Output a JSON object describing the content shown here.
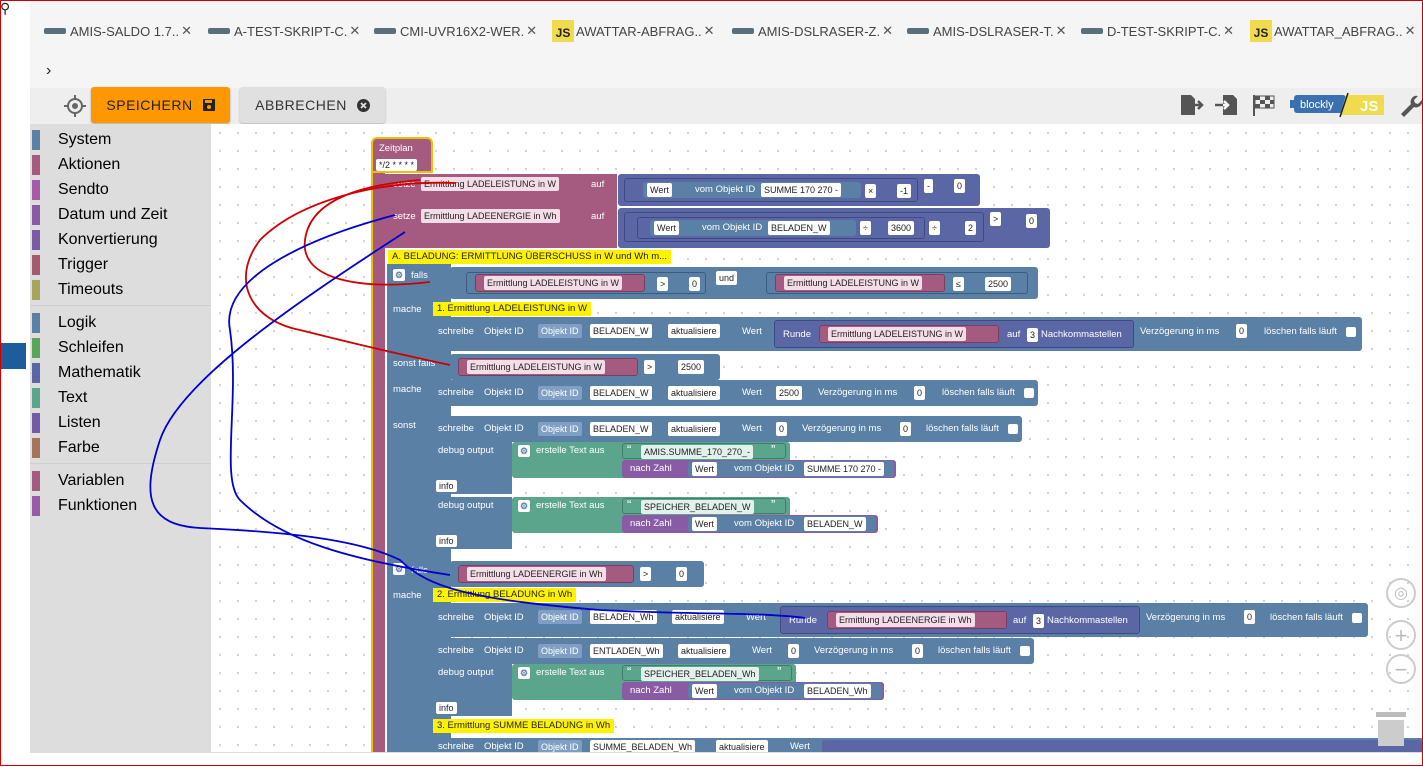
{
  "tabs": [
    {
      "label": "AMIS-SALDO 1.7..",
      "icon": "blockly-icon"
    },
    {
      "label": "A-TEST-SKRIPT-C.",
      "icon": "blockly-icon"
    },
    {
      "label": "CMI-UVR16X2-WER.",
      "icon": "blockly-icon"
    },
    {
      "label": "AWATTAR-ABFRAG..",
      "icon": "js-icon"
    },
    {
      "label": "AMIS-DSLRASER-Z.",
      "icon": "blockly-icon"
    },
    {
      "label": "AMIS-DSLRASER-T.",
      "icon": "blockly-icon"
    },
    {
      "label": "D-TEST-SKRIPT-C.",
      "icon": "blockly-icon"
    },
    {
      "label": "AWATTAR_ABFRAG..",
      "icon": "js-icon"
    }
  ],
  "tab_close": "✕",
  "tab_js": "JS",
  "tab_more": "›",
  "toolbar": {
    "save_label": "SPEICHERN",
    "cancel_label": "ABBRECHEN",
    "blockly_label": "blockly",
    "js_label": "JS",
    "save_color": "#ff9800"
  },
  "categories": [
    {
      "label": "System",
      "color": "#5b80a5"
    },
    {
      "label": "Aktionen",
      "color": "#a55b80"
    },
    {
      "label": "Sendto",
      "color": "#a55ba5"
    },
    {
      "label": "Datum und Zeit",
      "color": "#8a5ba5"
    },
    {
      "label": "Konvertierung",
      "color": "#7a5ba5"
    },
    {
      "label": "Trigger",
      "color": "#a55b6f"
    },
    {
      "label": "Timeouts",
      "color": "#a5a55b"
    },
    {
      "label": "Logik",
      "color": "#5b80a5"
    },
    {
      "label": "Schleifen",
      "color": "#5ba55b"
    },
    {
      "label": "Mathematik",
      "color": "#5b67a5"
    },
    {
      "label": "Text",
      "color": "#5ba58c"
    },
    {
      "label": "Listen",
      "color": "#745ba5"
    },
    {
      "label": "Farbe",
      "color": "#a5745b"
    },
    {
      "label": "Variablen",
      "color": "#a55b80"
    },
    {
      "label": "Funktionen",
      "color": "#995ba5"
    }
  ],
  "blocks": {
    "zeitplan": "Zeitplan",
    "cron": "*/2 * * * *",
    "setze": "setze",
    "auf": "auf",
    "var_leistung": "Ermittlung LADELEISTUNG in W",
    "var_energie": "Ermittlung LADEENERGIE in Wh",
    "wert": "Wert",
    "vom_objekt_id": "vom Objekt ID",
    "obj_summe": "SUMME 170 270 -",
    "obj_beladen_w": "BELADEN_W",
    "obj_beladen_w_case": "BELADEN_W",
    "obj_beladen_wh": "BELADEN_Wh",
    "obj_entladen_wh": "ENTLADEN_Wh",
    "obj_summe_beladen_wh": "SUMME_BELADEN_Wh",
    "op_mul": "×",
    "op_div": "÷",
    "op_minus": "-",
    "op_gt": ">",
    "op_le": "≤",
    "n_minus1": "-1",
    "n_0": "0",
    "n_3600": "3600",
    "n_2": "2",
    "n_2500": "2500",
    "n_3": "3",
    "comment_a": "A. BELADUNG: ERMITTLUNG ÜBERSCHUSS in W und Wh m...",
    "comment_1": "1. Ermittlung LADELEISTUNG in W",
    "comment_2": "2. Ermittlung BELADUNG in Wh",
    "comment_3": "3. Ermittlung SUMME BELADUNG in Wh",
    "falls": "falls",
    "mache": "mache",
    "sonst_falls": "sonst falls",
    "sonst": "sonst",
    "und": "und",
    "schreibe": "schreibe",
    "objekt_id": "Objekt ID",
    "aktualisiere": "aktualisiere",
    "runde": "Runde",
    "nachkomma": "Nachkommastellen",
    "verzoegerung": "Verzögerung in ms",
    "loeschen": "löschen falls läuft",
    "debug_output": "debug output",
    "erstelle_text": "erstelle Text aus",
    "nach_zahl": "nach Zahl",
    "info": "info",
    "txt_amis": "AMIS.SUMME_170_270_-",
    "txt_speicher_w": "SPEICHER_BELADEN_W",
    "txt_speicher_wh": "SPEICHER_BELADEN_Wh",
    "quote_open": "“",
    "quote_close": "”",
    "gear": "⚙",
    "dd": "▾"
  }
}
